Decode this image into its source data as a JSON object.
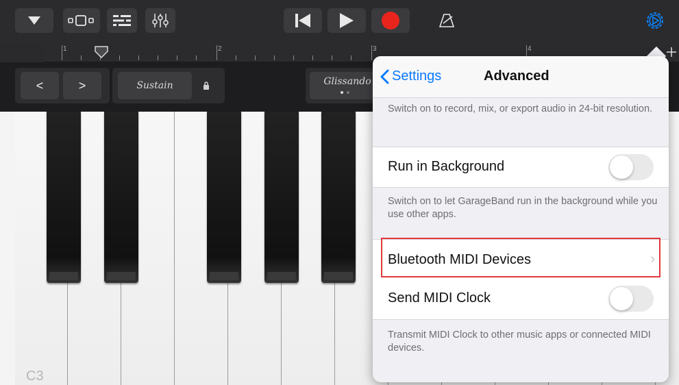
{
  "toolbar": {
    "icons": [
      "dropdown-triangle-icon",
      "tracks-view-icon",
      "track-controls-icon",
      "mixer-icon",
      "rewind-icon",
      "play-icon",
      "record-icon",
      "metronome-icon",
      "settings-gear-icon"
    ],
    "record_color": "#e8241d",
    "settings_color": "#0a84ff"
  },
  "ruler": {
    "bars": [
      "1",
      "2",
      "3",
      "4"
    ]
  },
  "controls": {
    "prev_label": "<",
    "next_label": ">",
    "sustain_label": "Sustain",
    "glissando_label": "Glissando"
  },
  "keyboard": {
    "note_label": "C3"
  },
  "settings": {
    "back_label": "Settings",
    "title": "Advanced",
    "top_footer": "Switch on to record, mix, or export audio in 24-bit resolution.",
    "run_in_background": {
      "label": "Run in Background",
      "on": false
    },
    "run_footer": "Switch on to let GarageBand run in the background while you use other apps.",
    "bluetooth_midi": {
      "label": "Bluetooth MIDI Devices",
      "chevron": "›"
    },
    "send_midi_clock": {
      "label": "Send MIDI Clock",
      "on": false
    },
    "midi_footer": "Transmit MIDI Clock to other music apps or connected MIDI devices."
  },
  "colors": {
    "accent": "#0a7aff",
    "highlight": "#e2383b"
  }
}
